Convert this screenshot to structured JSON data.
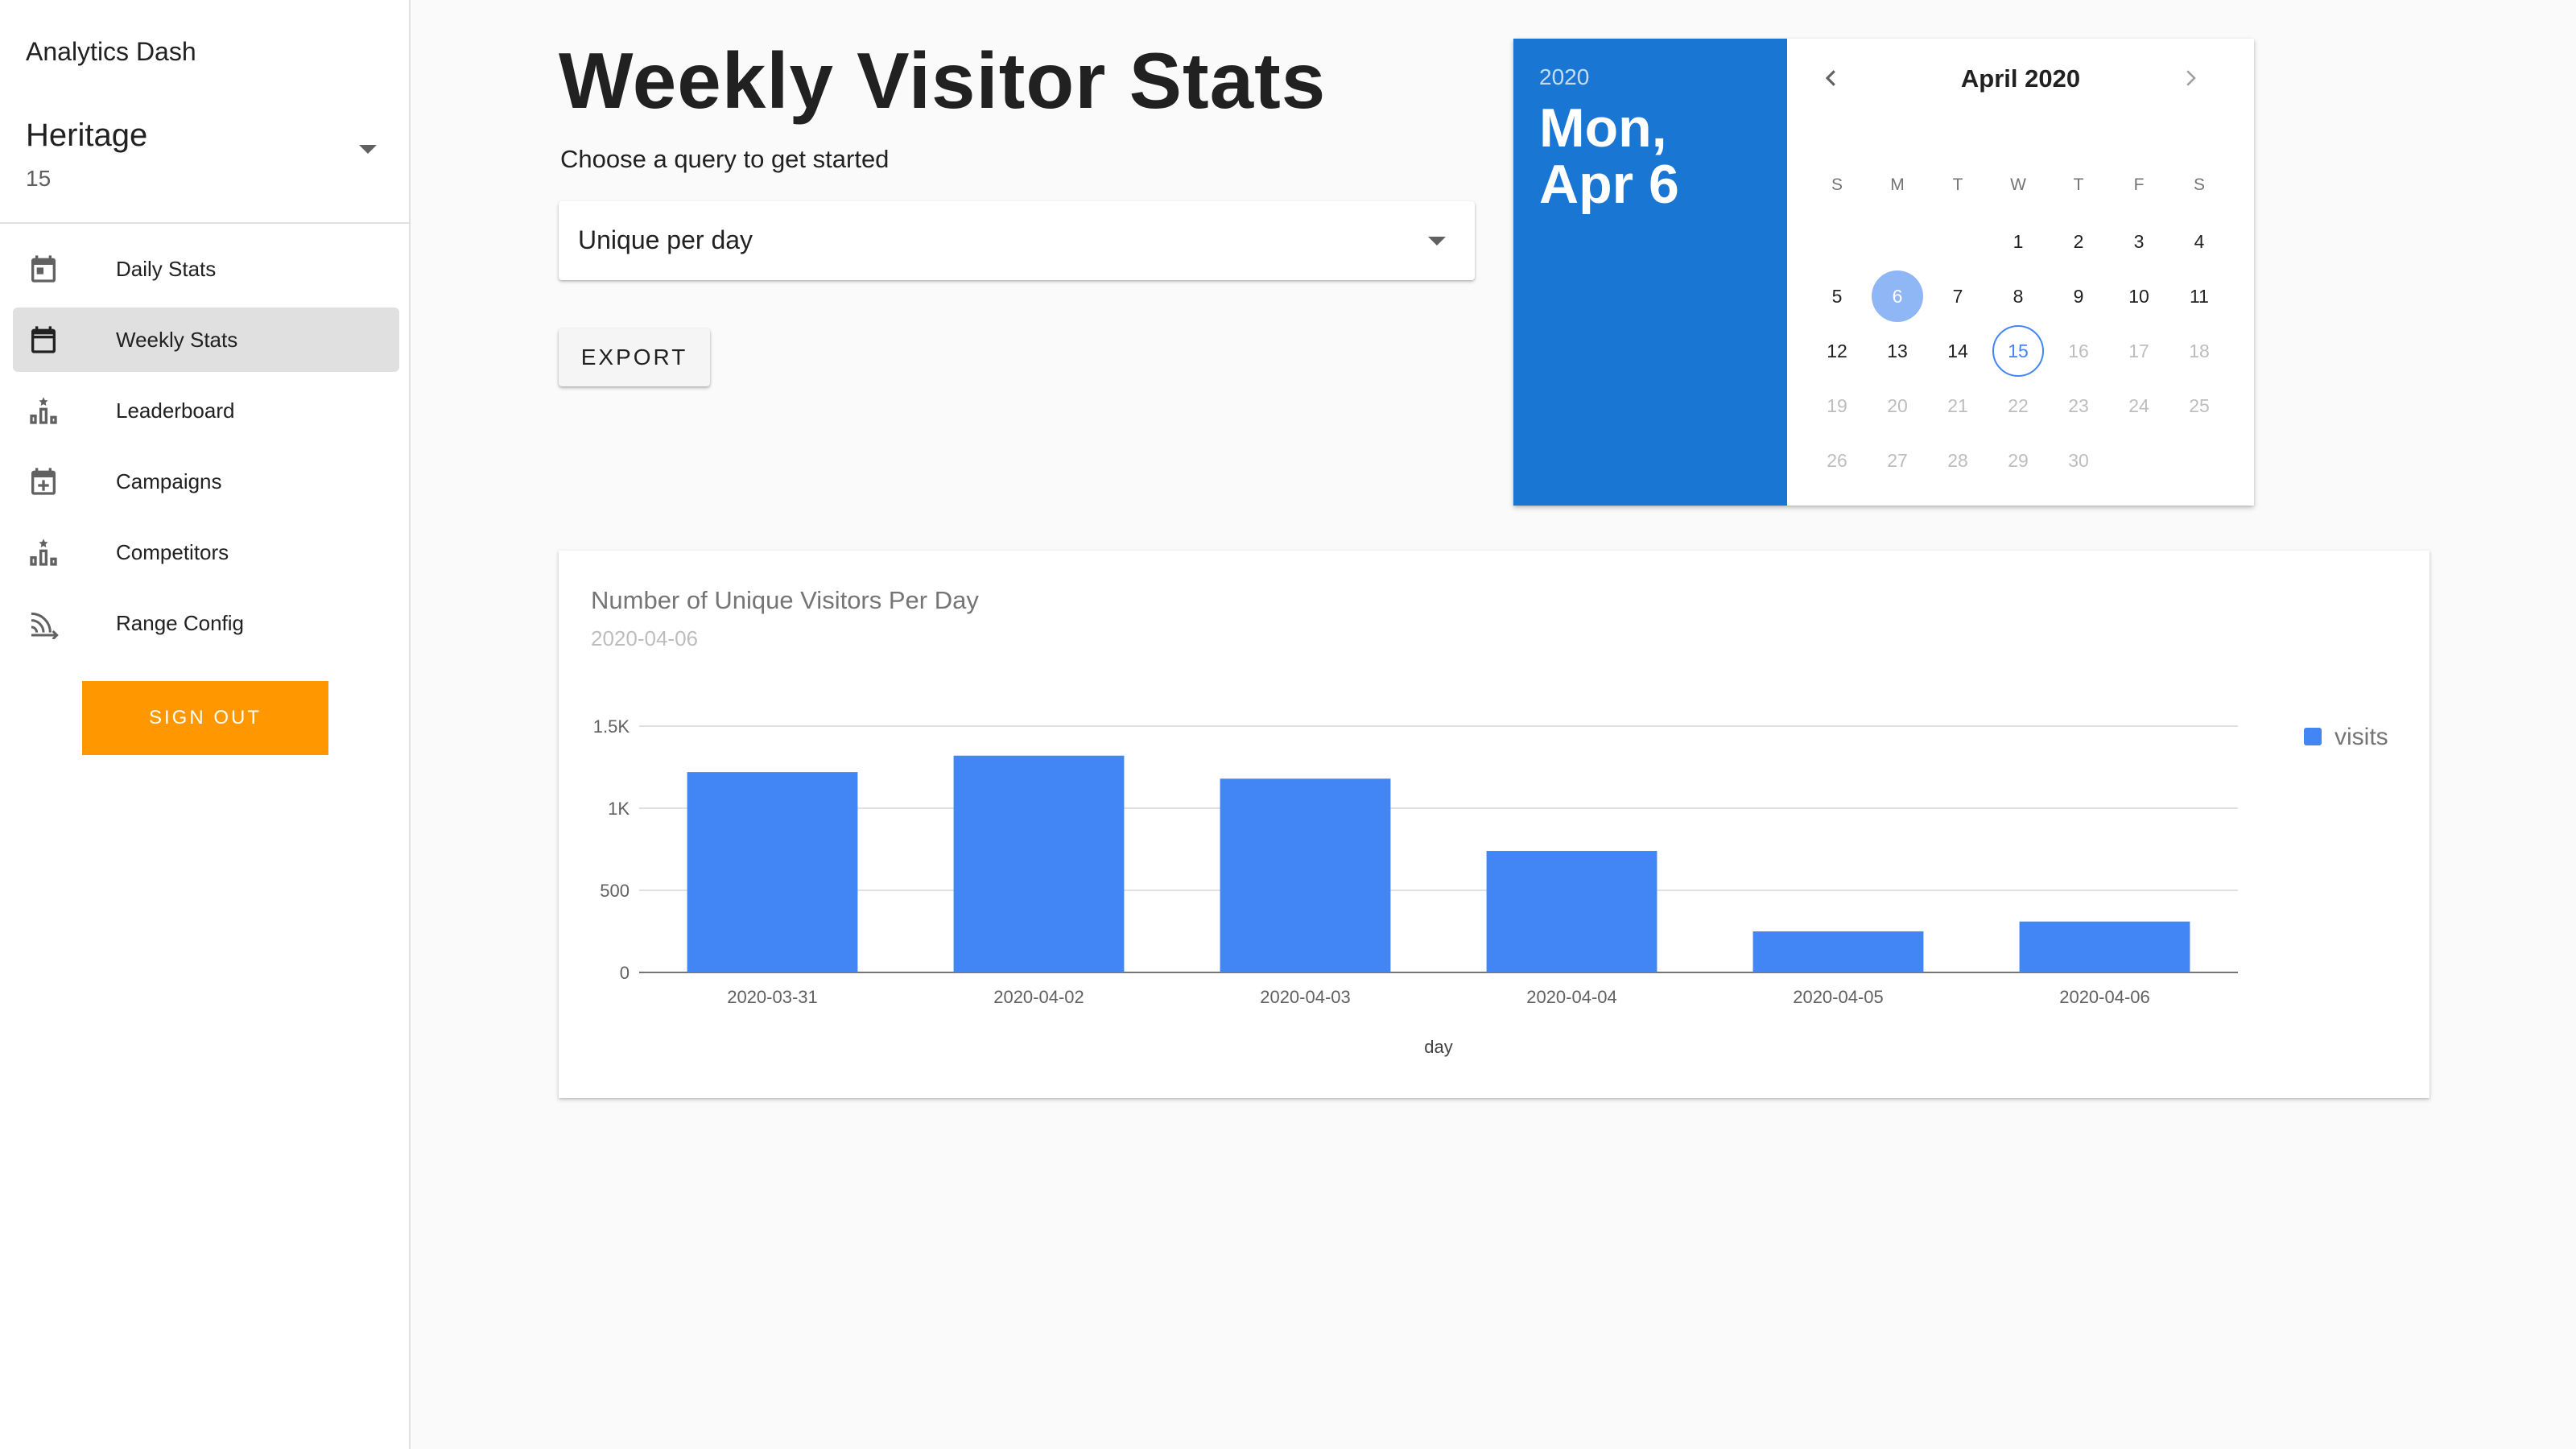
{
  "app": {
    "title": "Analytics Dash"
  },
  "project": {
    "name": "Heritage",
    "count": "15"
  },
  "sidebar": {
    "items": [
      {
        "label": "Daily Stats",
        "icon": "calendar-icon",
        "active": false
      },
      {
        "label": "Weekly Stats",
        "icon": "calendar-week-icon",
        "active": true
      },
      {
        "label": "Leaderboard",
        "icon": "leaderboard-icon",
        "active": false
      },
      {
        "label": "Campaigns",
        "icon": "calendar-plus-icon",
        "active": false
      },
      {
        "label": "Competitors",
        "icon": "leaderboard-icon",
        "active": false
      },
      {
        "label": "Range Config",
        "icon": "range-icon",
        "active": false
      }
    ],
    "signout_label": "SIGN OUT"
  },
  "main": {
    "title": "Weekly Visitor Stats",
    "subtitle": "Choose a query to get started",
    "query_select": {
      "value": "Unique per day"
    },
    "export_label": "EXPORT"
  },
  "calendar": {
    "year": "2020",
    "selected_date": "Mon, Apr 6",
    "month_label": "April 2020",
    "weekdays": [
      "S",
      "M",
      "T",
      "W",
      "T",
      "F",
      "S"
    ],
    "first_weekday_index": 3,
    "days_in_month": 30,
    "selected_day": 6,
    "today_day": 15,
    "max_enabled_day": 15,
    "colors": {
      "header": "#1976d2",
      "selected": "#90b7f5",
      "today": "#4285f4"
    }
  },
  "chart": {
    "title": "Number of Unique Visitors Per Day",
    "subtitle": "2020-04-06"
  },
  "chart_data": {
    "type": "bar",
    "title": "Number of Unique Visitors Per Day",
    "subtitle": "2020-04-06",
    "categories": [
      "2020-03-31",
      "2020-04-02",
      "2020-04-03",
      "2020-04-04",
      "2020-04-05",
      "2020-04-06"
    ],
    "series": [
      {
        "name": "visits",
        "values": [
          1220,
          1320,
          1180,
          740,
          250,
          310
        ],
        "color": "#4285f4"
      }
    ],
    "xlabel": "day",
    "ylabel": "",
    "ylim": [
      0,
      1500
    ],
    "yticks": [
      {
        "value": 0,
        "label": "0"
      },
      {
        "value": 500,
        "label": "500"
      },
      {
        "value": 1000,
        "label": "1K"
      },
      {
        "value": 1500,
        "label": "1.5K"
      }
    ],
    "grid": true,
    "legend": "top-right"
  }
}
